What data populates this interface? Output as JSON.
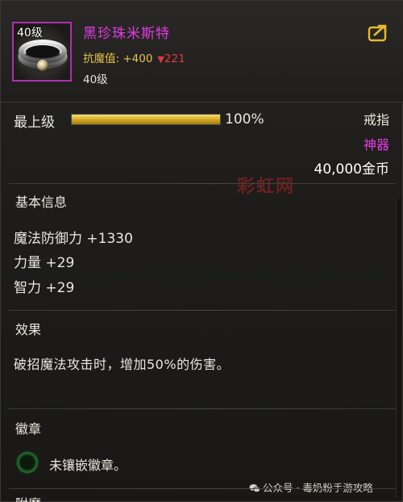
{
  "item": {
    "icon_level": "40级",
    "name": "黑珍珠米斯特",
    "resist_label": "抗魔值: +400",
    "resist_drop": "221",
    "level": "40级",
    "icon": "ring-icon",
    "rarity_color": "#e23ce2"
  },
  "rank": {
    "label": "最上级",
    "percent_text": "100%",
    "fill_fraction": 1.0
  },
  "meta": {
    "type": "戒指",
    "rarity": "神器",
    "price": "40,000金币"
  },
  "watermark": {
    "text": "彩虹网",
    "footer": "公众号 · 毒奶粉手游攻略"
  },
  "sections": {
    "basic": {
      "title": "基本信息",
      "stats": [
        "魔法防御力 +1330",
        "力量 +29",
        "智力 +29"
      ]
    },
    "effect": {
      "title": "效果",
      "text": "破招魔法攻击时，增加50%的伤害。"
    },
    "emblem": {
      "title": "徽章",
      "socket_label": "未镶嵌徽章。"
    },
    "next": {
      "title": "附魔"
    }
  },
  "icons": {
    "share": "share-icon",
    "socket": "socket-icon",
    "wechat": "wechat-icon"
  }
}
